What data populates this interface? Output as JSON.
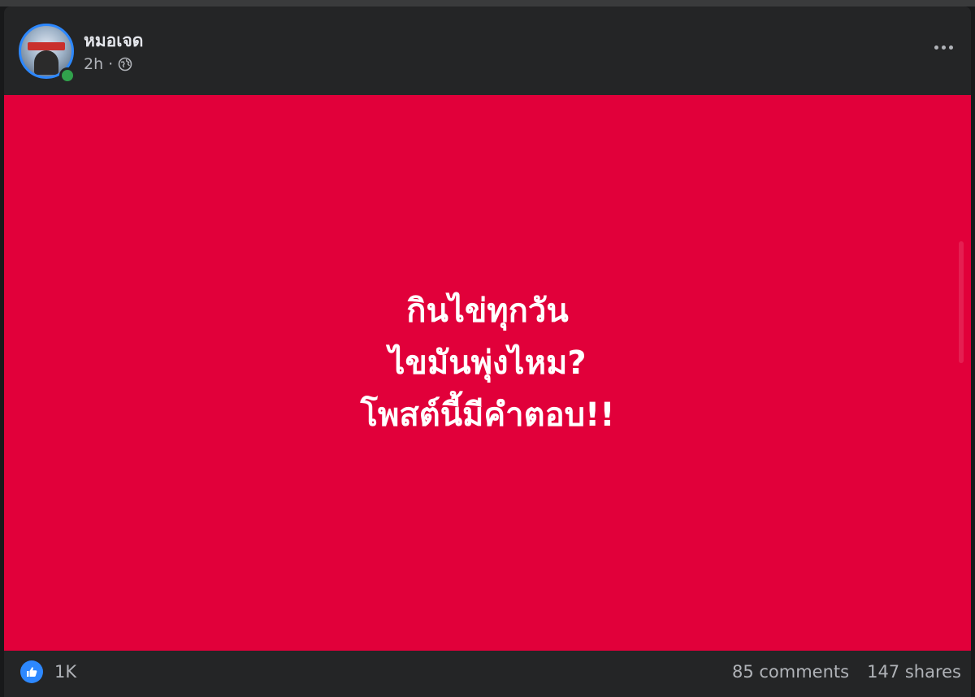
{
  "post": {
    "author": "หมอเจด",
    "time": "2h",
    "separator": "·",
    "privacy_icon": "globe-icon",
    "more_icon": "more-icon",
    "image": {
      "background": "#e1003a",
      "lines": [
        "กินไข่ทุกวัน",
        "ไขมันพุ่งไหม?",
        "โพสต์นี้มีคำตอบ!!"
      ]
    },
    "reactions": {
      "icon": "like-icon",
      "count": "1K"
    },
    "comments": "85 comments",
    "shares": "147 shares"
  },
  "colors": {
    "page_bg": "#18191a",
    "card_bg": "#242526",
    "accent": "#2d88ff",
    "online": "#31a24c",
    "muted_text": "#b0b3b8"
  }
}
